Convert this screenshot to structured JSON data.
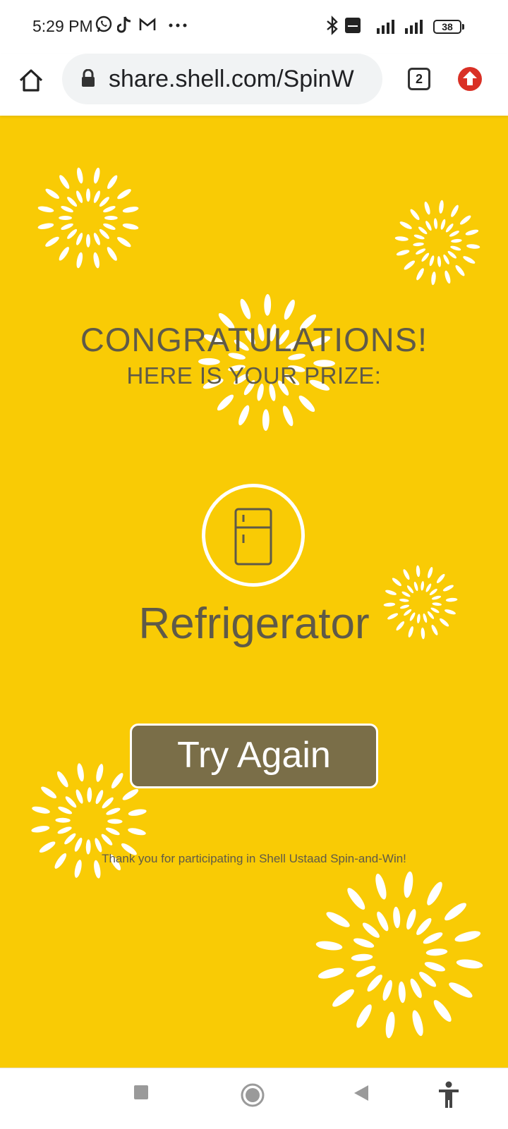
{
  "status_bar": {
    "time": "5:29 PM",
    "battery": "38",
    "icons": [
      "whatsapp-icon",
      "tiktok-icon",
      "gmail-icon",
      "more-dots-icon",
      "bluetooth-icon",
      "volte-icon",
      "signal-icon",
      "signal-icon"
    ]
  },
  "browser": {
    "url": "share.shell.com/SpinW",
    "tab_count": "2"
  },
  "page": {
    "heading": "CONGRATULATIONS!",
    "subheading": "HERE IS YOUR PRIZE:",
    "prize_icon": "refrigerator-icon",
    "prize": "Refrigerator",
    "button_label": "Try Again",
    "thanks_text": "Thank you for participating in Shell Ustaad Spin-and-Win!"
  },
  "colors": {
    "background": "#f9cb05",
    "text": "#5f5a48",
    "button": "#7a6e48"
  },
  "nav": [
    "recent-apps-icon",
    "home-circle-icon",
    "back-icon",
    "accessibility-icon"
  ]
}
